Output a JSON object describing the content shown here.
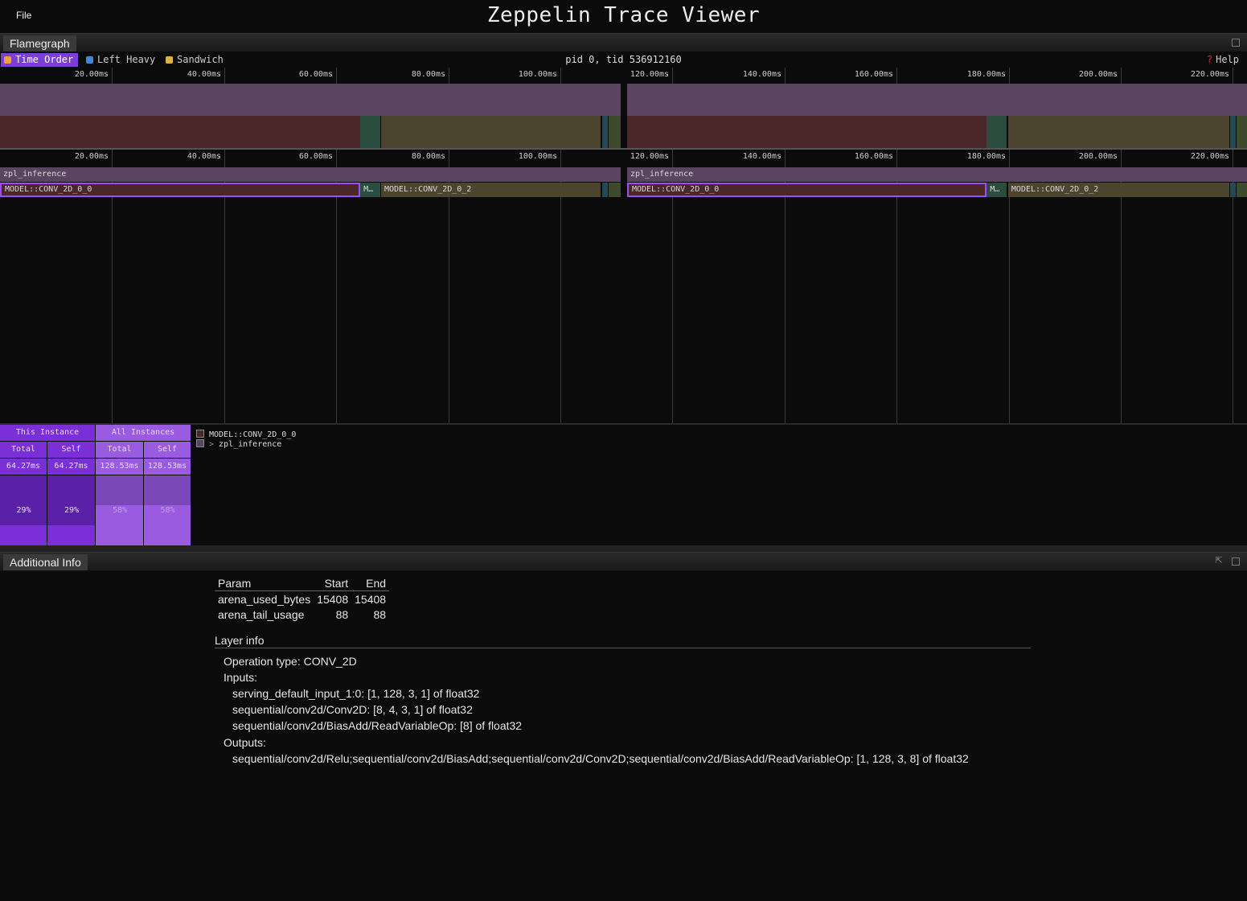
{
  "menu": {
    "file": "File"
  },
  "app": {
    "title": "Zeppelin Trace Viewer"
  },
  "flamegraph_panel": {
    "tab_label": "Flamegraph",
    "views": [
      {
        "label": "Time Order",
        "icon": "clock-icon",
        "active": true
      },
      {
        "label": "Left Heavy",
        "icon": "left-arrow-icon",
        "active": false
      },
      {
        "label": "Sandwich",
        "icon": "sandwich-icon",
        "active": false
      }
    ],
    "thread": "pid 0, tid 536912160",
    "help": "Help",
    "ticks": [
      "20.00ms",
      "40.00ms",
      "60.00ms",
      "80.00ms",
      "100.00ms",
      "120.00ms",
      "140.00ms",
      "160.00ms",
      "180.00ms",
      "200.00ms",
      "220.00ms"
    ],
    "frames_depth0": [
      {
        "name": "zpl_inference",
        "start_ms": 0,
        "end_ms": 110.8
      },
      {
        "name": "zpl_inference",
        "start_ms": 111.9,
        "end_ms": 222.7
      }
    ],
    "frames_depth1": [
      {
        "name": "MODEL::CONV_2D_0_0",
        "start_ms": 0,
        "end_ms": 64.27,
        "selected": true,
        "color": "#4a2728"
      },
      {
        "name": "M…",
        "start_ms": 64.3,
        "end_ms": 67.8,
        "color": "#2b4d3f"
      },
      {
        "name": "MODEL::CONV_2D_0_2",
        "start_ms": 68.0,
        "end_ms": 107.2,
        "color": "#4d4430"
      },
      {
        "name": "",
        "start_ms": 107.4,
        "end_ms": 108.4,
        "color": "#254a57"
      },
      {
        "name": "",
        "start_ms": 108.6,
        "end_ms": 110.8,
        "color": "#3d4a2c"
      },
      {
        "name": "MODEL::CONV_2D_0_0",
        "start_ms": 111.9,
        "end_ms": 176.0,
        "selected": true,
        "color": "#4a2728"
      },
      {
        "name": "M…",
        "start_ms": 176.1,
        "end_ms": 179.7,
        "color": "#2b4d3f"
      },
      {
        "name": "MODEL::CONV_2D_0_2",
        "start_ms": 179.9,
        "end_ms": 219.3,
        "color": "#4d4430"
      },
      {
        "name": "",
        "start_ms": 219.5,
        "end_ms": 220.5,
        "color": "#254a57"
      },
      {
        "name": "",
        "start_ms": 220.6,
        "end_ms": 222.7,
        "color": "#3d4a2c"
      }
    ]
  },
  "details": {
    "this_instance": {
      "header": "This Instance",
      "total_label": "Total",
      "self_label": "Self",
      "total": "64.27ms",
      "self": "64.27ms",
      "total_pct": "29%",
      "self_pct": "29%",
      "fraction": 0.29
    },
    "all_instances": {
      "header": "All Instances",
      "total_label": "Total",
      "self_label": "Self",
      "total": "128.53ms",
      "self": "128.53ms",
      "total_pct": "58%",
      "self_pct": "58%",
      "fraction": 0.58
    },
    "stack": [
      {
        "label": "MODEL::CONV_2D_0_0",
        "prefix": ""
      },
      {
        "label": "zpl_inference",
        "prefix": ">"
      }
    ]
  },
  "info_panel": {
    "tab_label": "Additional Info",
    "param_headers": [
      "Param",
      "Start",
      "End"
    ],
    "params": [
      {
        "name": "arena_used_bytes",
        "start": "15408",
        "end": "15408"
      },
      {
        "name": "arena_tail_usage",
        "start": "88",
        "end": "88"
      }
    ],
    "layer_title": "Layer info",
    "operation": "Operation type: CONV_2D",
    "inputs_label": "Inputs:",
    "inputs": [
      "serving_default_input_1:0: [1, 128, 3, 1] of float32",
      "sequential/conv2d/Conv2D: [8, 4, 3, 1] of float32",
      "sequential/conv2d/BiasAdd/ReadVariableOp: [8] of float32"
    ],
    "outputs_label": "Outputs:",
    "outputs": [
      "sequential/conv2d/Relu;sequential/conv2d/BiasAdd;sequential/conv2d/Conv2D;sequential/conv2d/BiasAdd/ReadVariableOp: [1, 128, 3, 8] of float32"
    ]
  },
  "colors": {
    "accent": "#7b3fd6",
    "root_frame": "#5a4560",
    "selected_border": "#9b4dff"
  }
}
